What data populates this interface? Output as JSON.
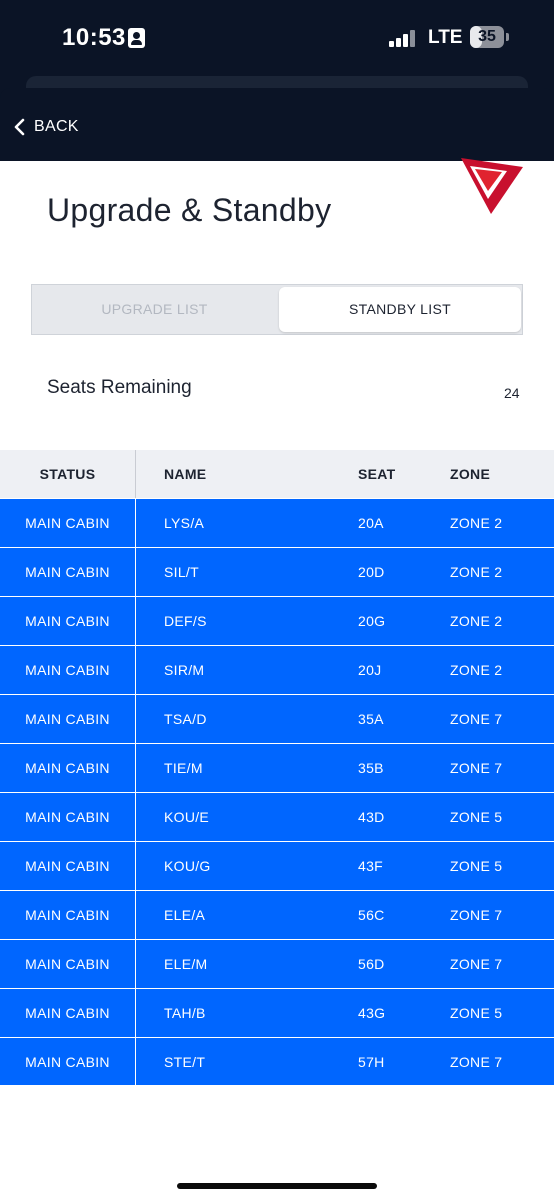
{
  "status_bar": {
    "time": "10:53",
    "network": "LTE",
    "battery": "35",
    "battery_fraction": 0.35
  },
  "nav": {
    "back_label": "BACK"
  },
  "page": {
    "title": "Upgrade & Standby"
  },
  "tabs": [
    {
      "label": "UPGRADE LIST",
      "selected": false
    },
    {
      "label": "STANDBY LIST",
      "selected": true
    }
  ],
  "seats_remaining": {
    "label": "Seats Remaining",
    "value": "24"
  },
  "table": {
    "columns": [
      "STATUS",
      "NAME",
      "SEAT",
      "ZONE"
    ],
    "rows": [
      [
        "MAIN CABIN",
        "LYS/A",
        "20A",
        "ZONE 2"
      ],
      [
        "MAIN CABIN",
        "SIL/T",
        "20D",
        "ZONE 2"
      ],
      [
        "MAIN CABIN",
        "DEF/S",
        "20G",
        "ZONE 2"
      ],
      [
        "MAIN CABIN",
        "SIR/M",
        "20J",
        "ZONE 2"
      ],
      [
        "MAIN CABIN",
        "TSA/D",
        "35A",
        "ZONE 7"
      ],
      [
        "MAIN CABIN",
        "TIE/M",
        "35B",
        "ZONE 7"
      ],
      [
        "MAIN CABIN",
        "KOU/E",
        "43D",
        "ZONE 5"
      ],
      [
        "MAIN CABIN",
        "KOU/G",
        "43F",
        "ZONE 5"
      ],
      [
        "MAIN CABIN",
        "ELE/A",
        "56C",
        "ZONE 7"
      ],
      [
        "MAIN CABIN",
        "ELE/M",
        "56D",
        "ZONE 7"
      ],
      [
        "MAIN CABIN",
        "TAH/B",
        "43G",
        "ZONE 5"
      ],
      [
        "MAIN CABIN",
        "STE/T",
        "57H",
        "ZONE 7"
      ]
    ]
  },
  "colors": {
    "header_bg": "#0b1426",
    "row_bg": "#0066ff",
    "brand_red": "#c8102e"
  },
  "icons": {
    "back": "chevron-left-icon",
    "logo": "delta-widget-logo-icon"
  }
}
